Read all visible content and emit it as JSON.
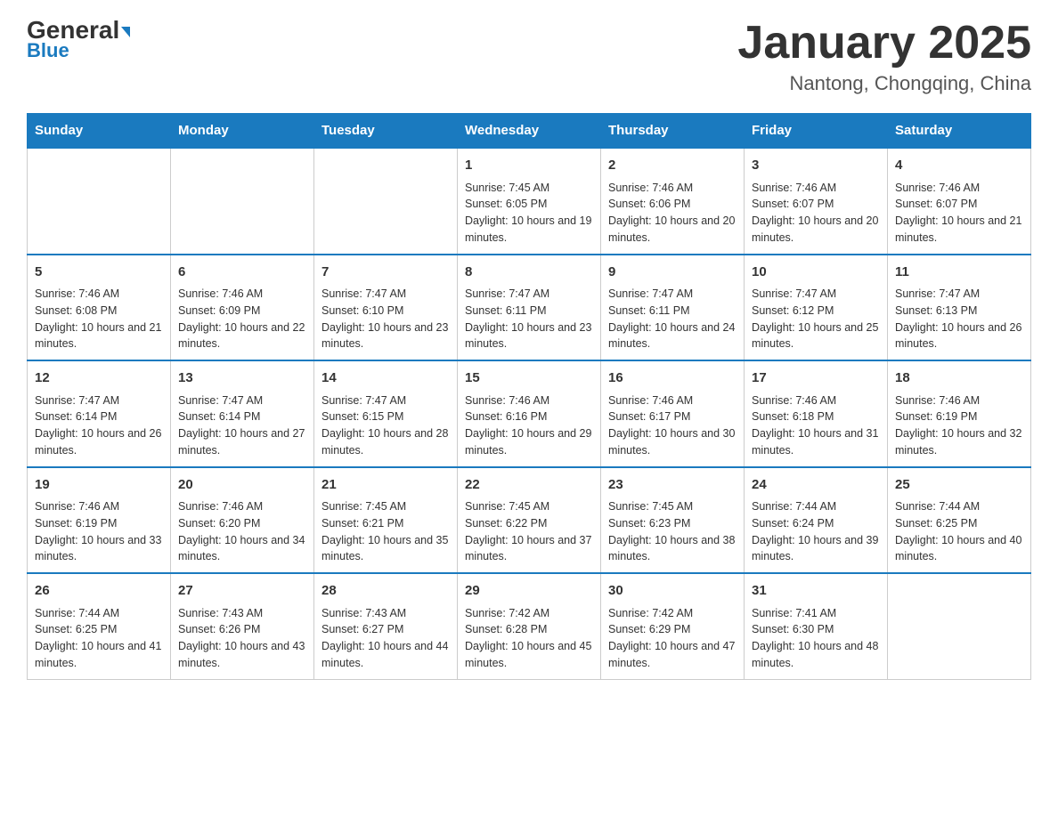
{
  "header": {
    "logo_general": "General",
    "logo_blue": "Blue",
    "month_title": "January 2025",
    "location": "Nantong, Chongqing, China"
  },
  "days_of_week": [
    "Sunday",
    "Monday",
    "Tuesday",
    "Wednesday",
    "Thursday",
    "Friday",
    "Saturday"
  ],
  "weeks": [
    [
      null,
      null,
      null,
      {
        "day": 1,
        "sunrise": "7:45 AM",
        "sunset": "6:05 PM",
        "daylight": "10 hours and 19 minutes."
      },
      {
        "day": 2,
        "sunrise": "7:46 AM",
        "sunset": "6:06 PM",
        "daylight": "10 hours and 20 minutes."
      },
      {
        "day": 3,
        "sunrise": "7:46 AM",
        "sunset": "6:07 PM",
        "daylight": "10 hours and 20 minutes."
      },
      {
        "day": 4,
        "sunrise": "7:46 AM",
        "sunset": "6:07 PM",
        "daylight": "10 hours and 21 minutes."
      }
    ],
    [
      {
        "day": 5,
        "sunrise": "7:46 AM",
        "sunset": "6:08 PM",
        "daylight": "10 hours and 21 minutes."
      },
      {
        "day": 6,
        "sunrise": "7:46 AM",
        "sunset": "6:09 PM",
        "daylight": "10 hours and 22 minutes."
      },
      {
        "day": 7,
        "sunrise": "7:47 AM",
        "sunset": "6:10 PM",
        "daylight": "10 hours and 23 minutes."
      },
      {
        "day": 8,
        "sunrise": "7:47 AM",
        "sunset": "6:11 PM",
        "daylight": "10 hours and 23 minutes."
      },
      {
        "day": 9,
        "sunrise": "7:47 AM",
        "sunset": "6:11 PM",
        "daylight": "10 hours and 24 minutes."
      },
      {
        "day": 10,
        "sunrise": "7:47 AM",
        "sunset": "6:12 PM",
        "daylight": "10 hours and 25 minutes."
      },
      {
        "day": 11,
        "sunrise": "7:47 AM",
        "sunset": "6:13 PM",
        "daylight": "10 hours and 26 minutes."
      }
    ],
    [
      {
        "day": 12,
        "sunrise": "7:47 AM",
        "sunset": "6:14 PM",
        "daylight": "10 hours and 26 minutes."
      },
      {
        "day": 13,
        "sunrise": "7:47 AM",
        "sunset": "6:14 PM",
        "daylight": "10 hours and 27 minutes."
      },
      {
        "day": 14,
        "sunrise": "7:47 AM",
        "sunset": "6:15 PM",
        "daylight": "10 hours and 28 minutes."
      },
      {
        "day": 15,
        "sunrise": "7:46 AM",
        "sunset": "6:16 PM",
        "daylight": "10 hours and 29 minutes."
      },
      {
        "day": 16,
        "sunrise": "7:46 AM",
        "sunset": "6:17 PM",
        "daylight": "10 hours and 30 minutes."
      },
      {
        "day": 17,
        "sunrise": "7:46 AM",
        "sunset": "6:18 PM",
        "daylight": "10 hours and 31 minutes."
      },
      {
        "day": 18,
        "sunrise": "7:46 AM",
        "sunset": "6:19 PM",
        "daylight": "10 hours and 32 minutes."
      }
    ],
    [
      {
        "day": 19,
        "sunrise": "7:46 AM",
        "sunset": "6:19 PM",
        "daylight": "10 hours and 33 minutes."
      },
      {
        "day": 20,
        "sunrise": "7:46 AM",
        "sunset": "6:20 PM",
        "daylight": "10 hours and 34 minutes."
      },
      {
        "day": 21,
        "sunrise": "7:45 AM",
        "sunset": "6:21 PM",
        "daylight": "10 hours and 35 minutes."
      },
      {
        "day": 22,
        "sunrise": "7:45 AM",
        "sunset": "6:22 PM",
        "daylight": "10 hours and 37 minutes."
      },
      {
        "day": 23,
        "sunrise": "7:45 AM",
        "sunset": "6:23 PM",
        "daylight": "10 hours and 38 minutes."
      },
      {
        "day": 24,
        "sunrise": "7:44 AM",
        "sunset": "6:24 PM",
        "daylight": "10 hours and 39 minutes."
      },
      {
        "day": 25,
        "sunrise": "7:44 AM",
        "sunset": "6:25 PM",
        "daylight": "10 hours and 40 minutes."
      }
    ],
    [
      {
        "day": 26,
        "sunrise": "7:44 AM",
        "sunset": "6:25 PM",
        "daylight": "10 hours and 41 minutes."
      },
      {
        "day": 27,
        "sunrise": "7:43 AM",
        "sunset": "6:26 PM",
        "daylight": "10 hours and 43 minutes."
      },
      {
        "day": 28,
        "sunrise": "7:43 AM",
        "sunset": "6:27 PM",
        "daylight": "10 hours and 44 minutes."
      },
      {
        "day": 29,
        "sunrise": "7:42 AM",
        "sunset": "6:28 PM",
        "daylight": "10 hours and 45 minutes."
      },
      {
        "day": 30,
        "sunrise": "7:42 AM",
        "sunset": "6:29 PM",
        "daylight": "10 hours and 47 minutes."
      },
      {
        "day": 31,
        "sunrise": "7:41 AM",
        "sunset": "6:30 PM",
        "daylight": "10 hours and 48 minutes."
      },
      null
    ]
  ]
}
